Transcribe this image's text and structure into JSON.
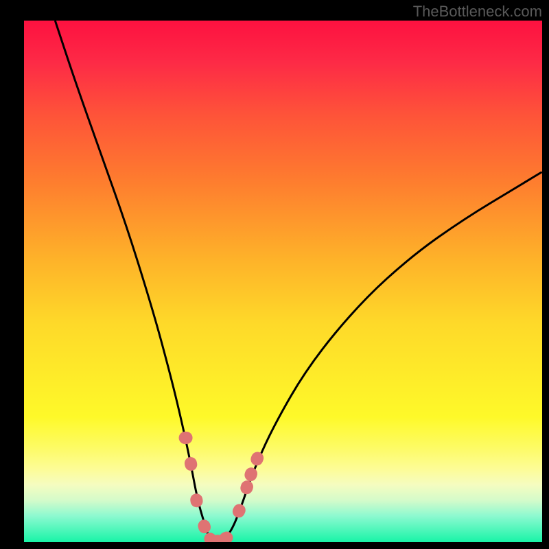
{
  "attribution": "TheBottleneck.com",
  "chart_data": {
    "type": "line",
    "title": "",
    "xlabel": "",
    "ylabel": "",
    "xlim": [
      0,
      100
    ],
    "ylim": [
      0,
      100
    ],
    "series": [
      {
        "name": "bottleneck-curve",
        "x": [
          6,
          10,
          15,
          20,
          25,
          28,
          30,
          32,
          33.5,
          35,
          36,
          37,
          38,
          40,
          42,
          44,
          48,
          55,
          65,
          75,
          85,
          95,
          100
        ],
        "values": [
          100,
          88,
          74,
          60,
          44,
          33,
          25,
          16,
          8,
          3,
          0,
          0,
          0,
          2,
          7,
          13,
          22,
          34,
          46,
          55,
          62,
          68,
          71
        ]
      }
    ],
    "markers": {
      "name": "highlighted-points",
      "color": "#df7373",
      "points": [
        {
          "x": 31.2,
          "y": 20
        },
        {
          "x": 32.2,
          "y": 15
        },
        {
          "x": 33.3,
          "y": 8
        },
        {
          "x": 34.8,
          "y": 3
        },
        {
          "x": 36.0,
          "y": 0.5
        },
        {
          "x": 37.5,
          "y": 0.2
        },
        {
          "x": 39.0,
          "y": 0.8
        },
        {
          "x": 41.5,
          "y": 6
        },
        {
          "x": 43.0,
          "y": 10.5
        },
        {
          "x": 43.8,
          "y": 13
        },
        {
          "x": 45.0,
          "y": 16
        }
      ]
    },
    "gradient_stops": [
      {
        "offset": 0,
        "color": "#fd1140"
      },
      {
        "offset": 0.5,
        "color": "#fed929"
      },
      {
        "offset": 0.82,
        "color": "#fdfb66"
      },
      {
        "offset": 1.0,
        "color": "#18f4a7"
      }
    ]
  }
}
